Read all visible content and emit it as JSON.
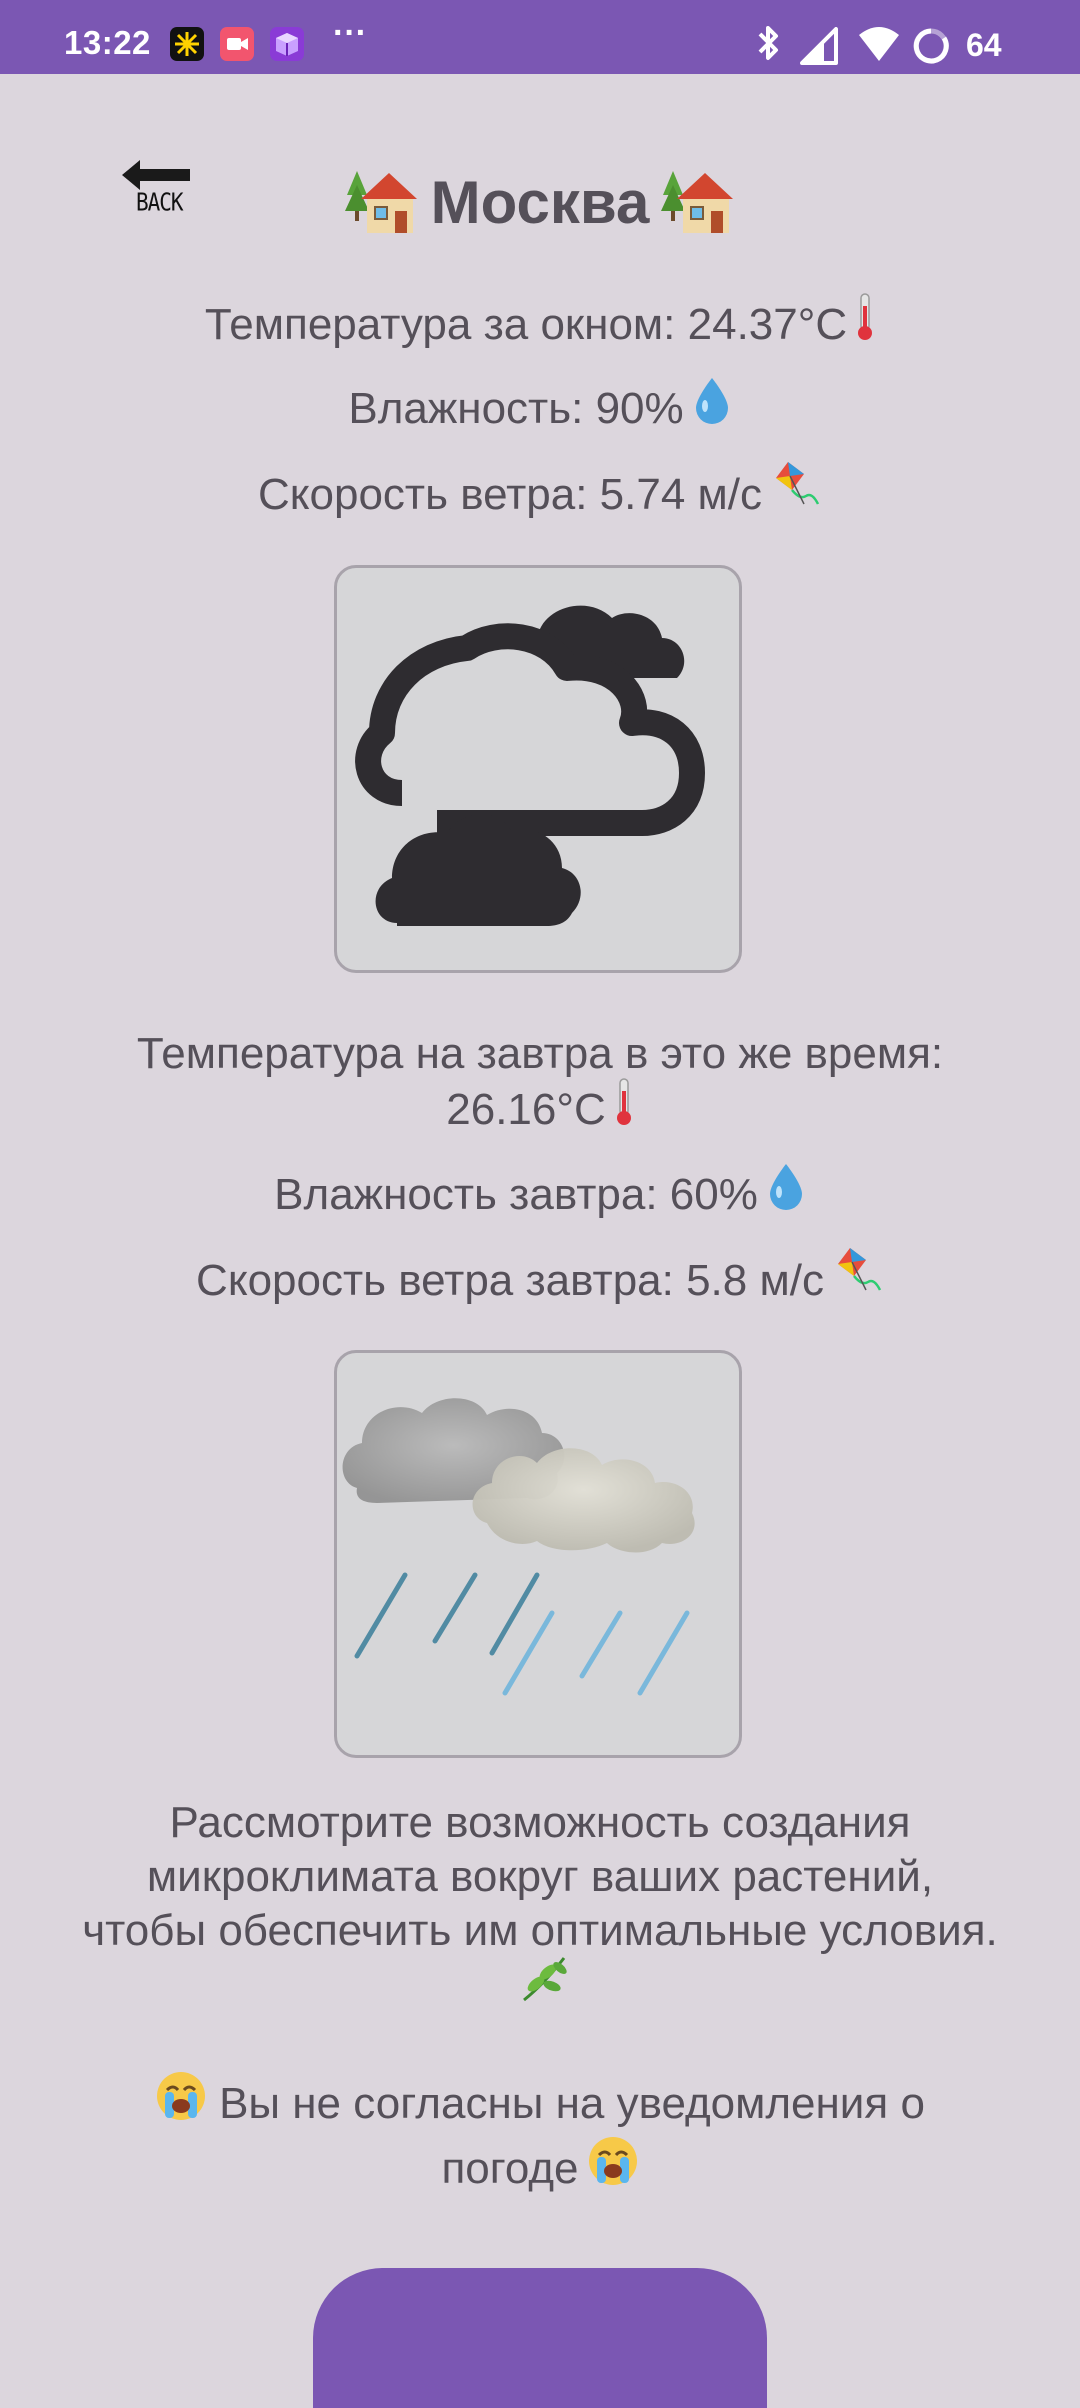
{
  "status_bar": {
    "time": "13:22",
    "dots": "···",
    "battery": "64",
    "colors": {
      "bar": "#7b57b3"
    }
  },
  "header": {
    "back_label": "BACK",
    "city": "Москва"
  },
  "current": {
    "temperature": "Температура за окном: 24.37°C",
    "humidity": "Влажность: 90%",
    "wind": "Скорость ветра: 5.74 м/с",
    "icon": "cloudy-icon"
  },
  "tomorrow": {
    "temperature_line1": "Температура на завтра в это же время:",
    "temperature_line2": "26.16°C",
    "humidity": "Влажность завтра: 60%",
    "wind": "Скорость ветра завтра: 5.8 м/с",
    "icon": "rain-icon"
  },
  "tip": {
    "text": "Рассмотрите возможность создания микроклимата вокруг ваших растений, чтобы обеспечить им оптимальные условия."
  },
  "notifications": {
    "text_main": "Вы не согласны на уведомления о",
    "text_end": "погоде"
  },
  "colors": {
    "background": "#dcd6dd",
    "accent": "#7b57b3",
    "text": "#555059"
  }
}
